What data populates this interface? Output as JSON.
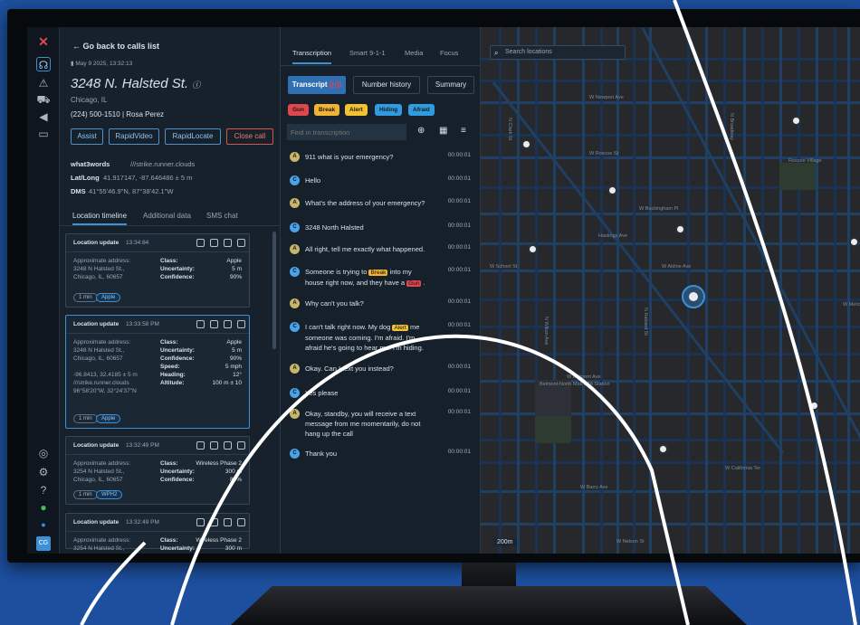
{
  "app": {
    "logo": "x-logo-icon",
    "back_label": "Go back to calls list",
    "date": "May 9 2025, 13:32:13",
    "address": "3248 N. Halsted St.",
    "city": "Chicago, IL",
    "phone": "(224) 500-1510",
    "caller": "Rosa Perez",
    "actions": [
      "Assist",
      "RapidVideo",
      "RapidLocate",
      "Close call"
    ],
    "w3w_label": "what3words",
    "w3w_value": "///strike.runner.clouds",
    "latlong_label": "Lat/Long",
    "latlong_value": "41.917147, -87.646486 ± 5 m",
    "dms_label": "DMS",
    "dms_value": "41°55'46.9\"N, 87°38'42.1\"W",
    "tabs": [
      "Location timeline",
      "Additional data",
      "SMS chat"
    ]
  },
  "timeline": [
    {
      "title": "Location update",
      "time": "13:34:84",
      "addr_label": "Approximate address:",
      "addr": [
        "3248 N Halsted St.,",
        "Chicago, IL, 60657"
      ],
      "rows": [
        [
          "Class:",
          "Apple"
        ],
        [
          "Uncertainty:",
          "5 m"
        ],
        [
          "Confidence:",
          "90%"
        ]
      ],
      "chips": [
        "1 min",
        "Apple"
      ]
    },
    {
      "title": "Location update",
      "time": "13:33:58 PM",
      "addr_label": "Approximate address:",
      "addr": [
        "3248 N Halsted St.,",
        "Chicago, IL, 60657"
      ],
      "extra": [
        "-96.8413, 32.4185 ± 5 m",
        "///strike.runner.clouds",
        "96°58'20\"W, 32°24'37\"N"
      ],
      "rows": [
        [
          "Class:",
          "Apple"
        ],
        [
          "Uncertainty:",
          "5 m"
        ],
        [
          "Confidence:",
          "90%"
        ],
        [
          "Speed:",
          "5 mph"
        ],
        [
          "Heading:",
          "12°"
        ],
        [
          "Altitude:",
          "100 m ± 10"
        ]
      ],
      "chips": [
        "1 min",
        "Apple"
      ]
    },
    {
      "title": "Location update",
      "time": "13:32:49 PM",
      "addr_label": "Approximate address:",
      "addr": [
        "3254 N Halsted St.,",
        "Chicago, IL, 60657"
      ],
      "rows": [
        [
          "Class:",
          "Wireless Phase 2"
        ],
        [
          "Uncertainty:",
          "300 m"
        ],
        [
          "Confidence:",
          "80%"
        ]
      ],
      "chips": [
        "1 min",
        "WPH2"
      ]
    },
    {
      "title": "Location update",
      "time": "13:32:49 PM",
      "addr_label": "Approximate address:",
      "addr": [
        "3254 N Halsted St.,"
      ],
      "rows": [
        [
          "Class:",
          "Wireless Phase 2"
        ],
        [
          "Uncertainty:",
          "300 m"
        ]
      ],
      "chips": []
    }
  ],
  "mid": {
    "tabs": [
      "Transcription",
      "Smart 9-1-1",
      "Media",
      "Focus"
    ],
    "subtabs": [
      "Transcript",
      "Number history",
      "Summary"
    ],
    "keywords": [
      {
        "label": "Gun",
        "color": "#e0474c"
      },
      {
        "label": "Break",
        "color": "#f2b233"
      },
      {
        "label": "Alert",
        "color": "#f2c230"
      },
      {
        "label": "Hiding",
        "color": "#2f9be0"
      },
      {
        "label": "Afraid",
        "color": "#2f9be0"
      }
    ],
    "find_placeholder": "Find in transcription",
    "messages": [
      {
        "who": "A",
        "text": "911 what is your emergency?",
        "time": "00:00:01"
      },
      {
        "who": "C",
        "text": "Hello",
        "time": "00:00:01"
      },
      {
        "who": "A",
        "text": "What's the address of your emergency?",
        "time": "00:00:01"
      },
      {
        "who": "C",
        "text": "3248 North Halsted",
        "time": "00:00:01"
      },
      {
        "who": "A",
        "text": "All right, tell me exactly what happened.",
        "time": "00:00:01"
      },
      {
        "who": "C",
        "text": "Someone is trying to [Break] into my house right now, and they have a [Gun] .",
        "time": "00:00:01"
      },
      {
        "who": "A",
        "text": "Why can't you talk?",
        "time": "00:00:01"
      },
      {
        "who": "C",
        "text": "I can't talk right now. My dog [Alert] me someone was coming. I'm afraid. I'm afraid he's going to hear me. I'm hiding.",
        "time": "00:00:01"
      },
      {
        "who": "A",
        "text": "Okay. Can I text you instead?",
        "time": "00:00:01"
      },
      {
        "who": "C",
        "text": "Yes please",
        "time": "00:00:01"
      },
      {
        "who": "A",
        "text": "Okay, standby, you will receive a text message from me momentarily, do not hang up the call",
        "time": "00:00:01"
      },
      {
        "who": "C",
        "text": "Thank you",
        "time": "00:00:01"
      }
    ]
  },
  "map": {
    "search_placeholder": "Search locations",
    "scale": "200m",
    "streets": [
      "W Newport Ave",
      "W Roscoe St",
      "W Buckingham Pl",
      "Hastings Ave",
      "W School St",
      "W Aldine Ave",
      "W Belmont Ave",
      "W Barry Ave",
      "W Nelson St",
      "W California Ter",
      "W Melrose St",
      "N Clark St",
      "N Halsted St",
      "N Broadway",
      "N Wilton Ave",
      "Roscoe Village",
      "Belmont-North Mall CTA Station"
    ]
  },
  "colors": {
    "accent": "#3d8fd6",
    "danger": "#e0474c",
    "agent": "#c9b56a",
    "caller": "#4aa3e8"
  }
}
